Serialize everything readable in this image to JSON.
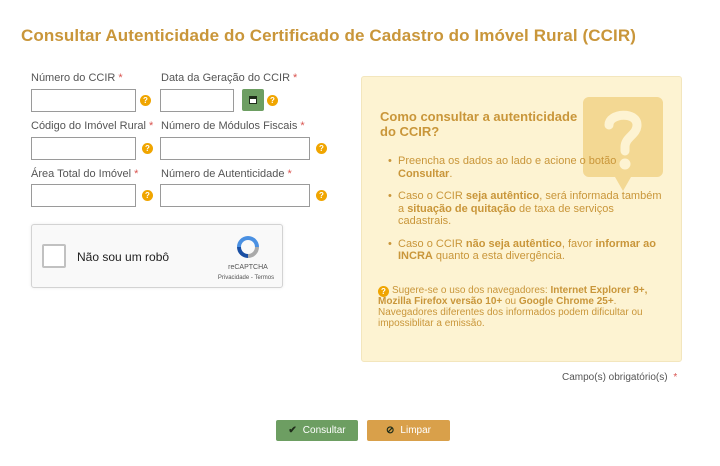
{
  "page": {
    "title": "Consultar Autenticidade do Certificado de Cadastro do Imóvel Rural (CCIR)"
  },
  "form": {
    "required_marker": "*",
    "fields": {
      "numero_ccir": {
        "label": "Número do CCIR",
        "value": ""
      },
      "data_geracao": {
        "label": "Data da Geração do CCIR",
        "value": ""
      },
      "codigo_imovel": {
        "label": "Código do Imóvel Rural",
        "value": ""
      },
      "modulos_fiscais": {
        "label": "Número de Módulos Fiscais",
        "value": ""
      },
      "area_total": {
        "label": "Área Total do Imóvel",
        "value": ""
      },
      "autenticidade": {
        "label": "Número de Autenticidade",
        "value": ""
      }
    },
    "help_glyph": "?",
    "calendar_icon": "calendar-icon"
  },
  "recaptcha": {
    "label": "Não sou um robô",
    "brand": "reCAPTCHA",
    "links": "Privacidade - Termos"
  },
  "info": {
    "title": "Como consultar a autenticidade do CCIR?",
    "items": [
      {
        "pre": "Preencha os dados ao lado e acione o botão ",
        "bold": "Consultar",
        "post": "."
      },
      {
        "pre": "Caso o CCIR ",
        "bold": "seja autêntico",
        "post": ", será informada também a ",
        "bold2": "situação de quitação",
        "post2": " de taxa de serviços cadastrais."
      },
      {
        "pre": "Caso o CCIR ",
        "bold": "não seja autêntico",
        "post": ", favor ",
        "bold2": "informar ao INCRA",
        "post2": " quanto a esta divergência."
      }
    ],
    "note": {
      "pre": "Sugere-se o uso dos navegadores: ",
      "bold": "Internet Explorer 9+, Mozilla Firefox versão 10+",
      "mid": " ou ",
      "bold2": "Google Chrome 25+",
      "post": ". Navegadores diferentes dos informados podem dificultar ou impossiblitar a emissão."
    },
    "colors": {
      "accent": "#c9963a",
      "background": "#fdf3d2",
      "question_mark": "#f3d893"
    }
  },
  "required_note": {
    "text": "Campo(s) obrigatório(s)",
    "marker": "*"
  },
  "buttons": {
    "consultar": {
      "label": "Consultar",
      "icon": "check-icon",
      "color": "#6d9e62"
    },
    "limpar": {
      "label": "Limpar",
      "icon": "ban-icon",
      "color": "#d9a04a"
    }
  }
}
